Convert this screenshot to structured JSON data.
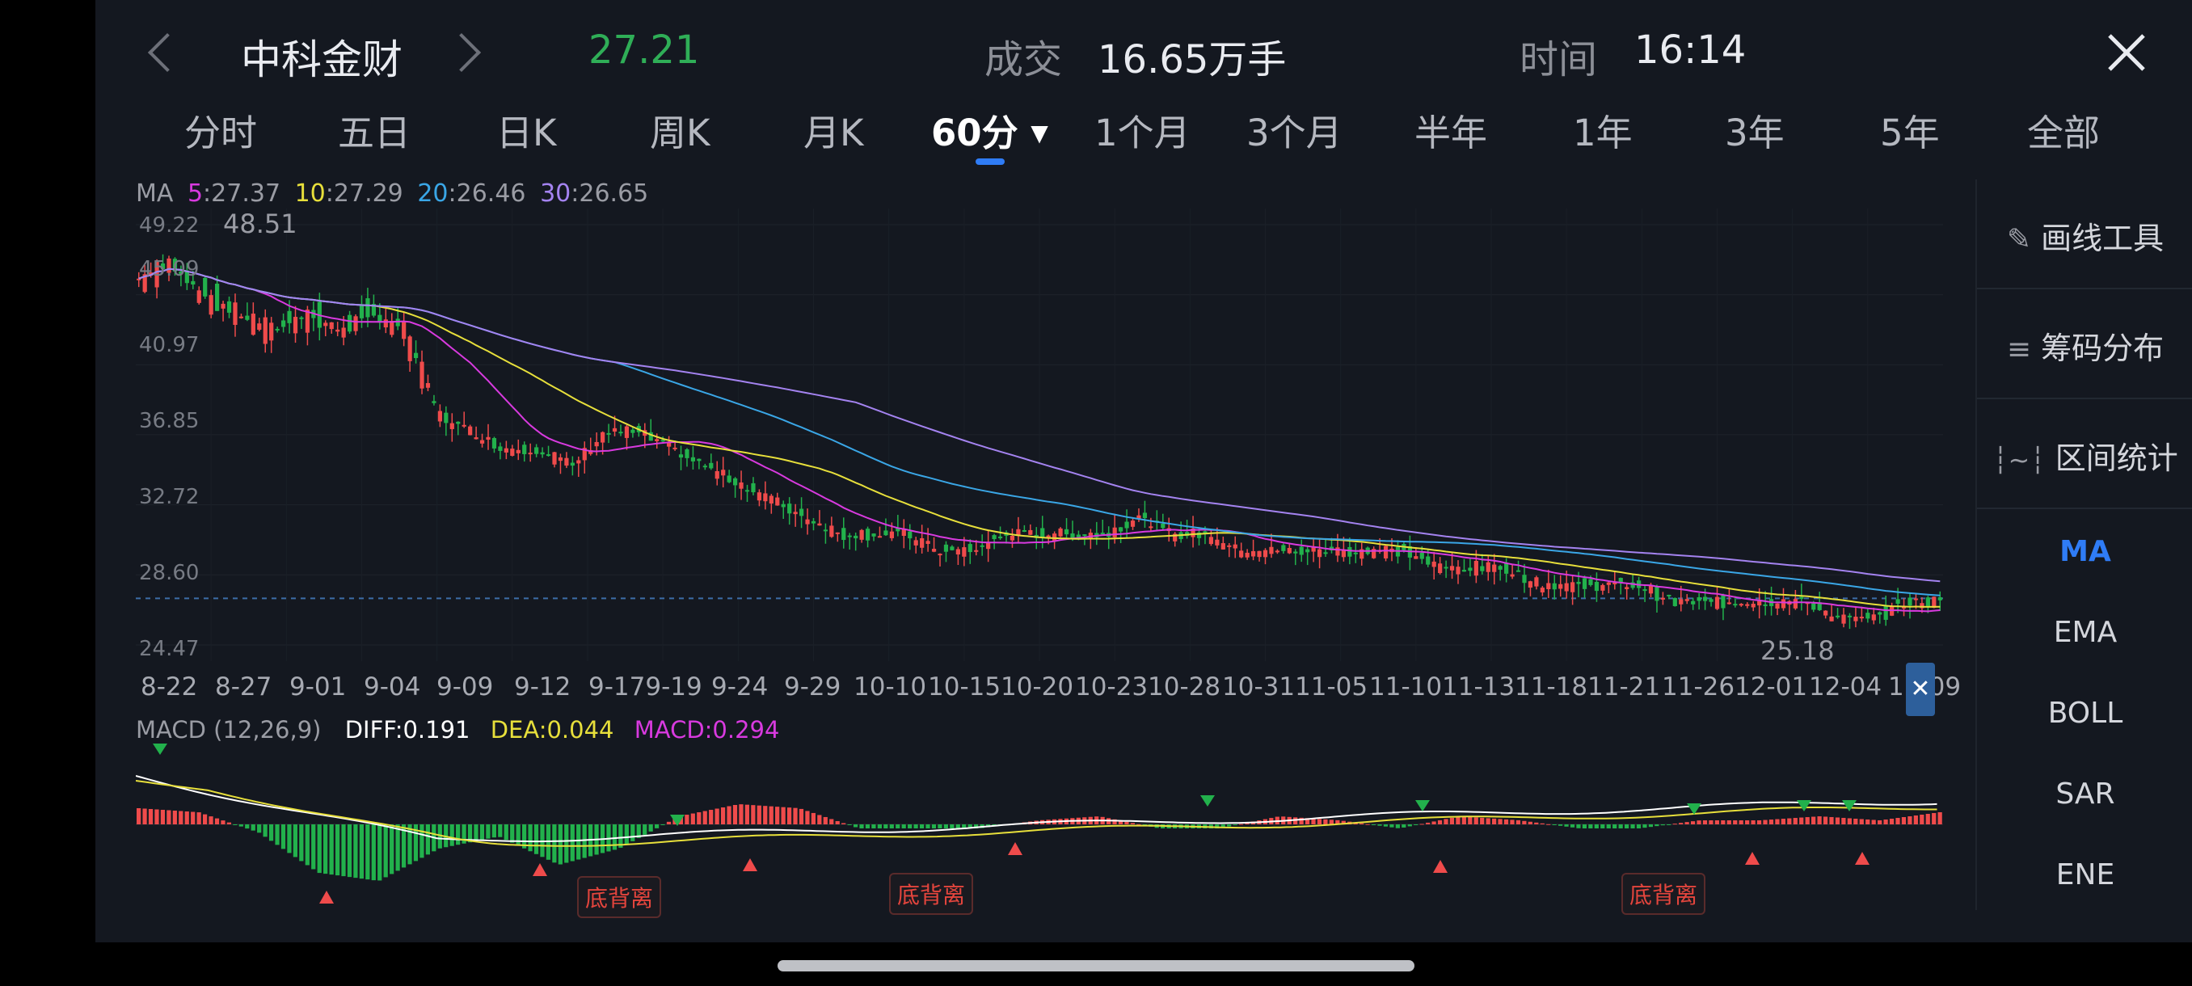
{
  "header": {
    "stock_name": "中科金财",
    "price": "27.21",
    "volume_label": "成交",
    "volume_value": "16.65万手",
    "time_label": "时间",
    "time_value": "16:14"
  },
  "tabs": [
    "分时",
    "五日",
    "日K",
    "周K",
    "月K",
    "60分",
    "1个月",
    "3个月",
    "半年",
    "1年",
    "3年",
    "5年",
    "全部"
  ],
  "active_tab": "60分",
  "ma_legend": {
    "title": "MA",
    "items": [
      {
        "key": "5",
        "value": ":27.37",
        "color": "#d83adf"
      },
      {
        "key": "10",
        "value": ":27.29",
        "color": "#e7df3b"
      },
      {
        "key": "20",
        "value": ":26.46",
        "color": "#3aa6e6"
      },
      {
        "key": "30",
        "value": ":26.65",
        "color": "#a483f0"
      }
    ]
  },
  "y_axis": [
    "49.22",
    "45.09",
    "40.97",
    "36.85",
    "32.72",
    "28.60",
    "24.47"
  ],
  "price_high_label": "48.51",
  "price_low_label": "25.18",
  "x_axis": [
    "8-22",
    "8-27",
    "9-01",
    "9-04",
    "9-09",
    "9-12",
    "9-179-19",
    "9-24",
    "9-29",
    "10-10",
    "10-15",
    "10-20",
    "10-23",
    "10-28",
    "10-31",
    "11-05",
    "11-10",
    "11-13",
    "11-18",
    "11-21",
    "11-26",
    "12-01",
    "12-04",
    "12-09"
  ],
  "macd_legend": {
    "title": "MACD",
    "params": "(12,26,9)",
    "diff": "DIFF:0.191",
    "dea": "DEA:0.044",
    "macd": "MACD:0.294"
  },
  "divergence_labels": [
    "底背离",
    "底背离",
    "底背离"
  ],
  "sidebar": {
    "tools": [
      "画线工具",
      "筹码分布",
      "区间统计"
    ],
    "indicators": [
      "MA",
      "EMA",
      "BOLL",
      "SAR",
      "ENE"
    ],
    "active_indicator": "MA"
  },
  "colors": {
    "up": "#ef4b4b",
    "down": "#22b14c",
    "ma5": "#d83adf",
    "ma10": "#e7df3b",
    "ma20": "#3aa6e6",
    "ma30": "#a483f0",
    "accent": "#2f7cf6"
  },
  "chart_data": {
    "type": "candlestick",
    "y_ticks": [
      49.22,
      45.09,
      40.97,
      36.85,
      32.72,
      28.6,
      24.47
    ],
    "ylim": [
      24.47,
      49.22
    ],
    "period": "60分",
    "close_approx": [
      46,
      47,
      45,
      44,
      43,
      44,
      43,
      44,
      43,
      38,
      37,
      36,
      36,
      35,
      37,
      37,
      36,
      35,
      34,
      33,
      32,
      31,
      31,
      31,
      30,
      30,
      31,
      31,
      31,
      31,
      32,
      31,
      31,
      30,
      30,
      30,
      30,
      30,
      30,
      29,
      29,
      29,
      28,
      28,
      28,
      28,
      27,
      27,
      27,
      27,
      27,
      26,
      26,
      27,
      27
    ],
    "macd_hist_approx": [
      0.4,
      0.3,
      -0.2,
      -1.2,
      -1.4,
      -0.6,
      -0.3,
      -1.0,
      -0.6,
      0.2,
      0.5,
      0.4,
      -0.1,
      -0.1,
      -0.1,
      0.1,
      0.2,
      -0.1,
      -0.1,
      0.2,
      0.1,
      -0.1,
      0.2,
      0.1,
      -0.1,
      -0.1,
      0.1,
      0.1,
      0.2,
      0.1,
      0.3
    ]
  }
}
